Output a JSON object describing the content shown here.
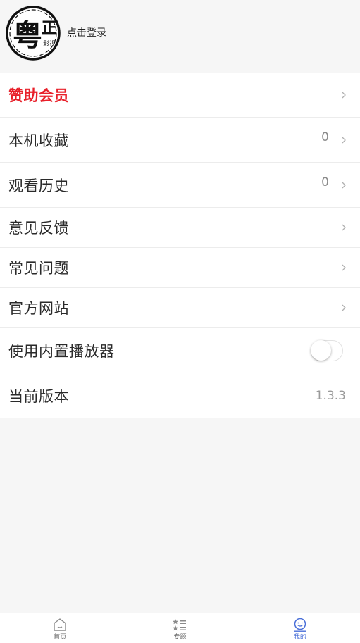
{
  "header": {
    "logo_char": "粤",
    "logo_side_char": "正",
    "logo_small_text": "影视",
    "login_label": "点击登录"
  },
  "list": {
    "sponsor": {
      "label": "赞助会员"
    },
    "favorites": {
      "label": "本机收藏",
      "count": "0"
    },
    "history": {
      "label": "观看历史",
      "count": "0"
    },
    "feedback": {
      "label": "意见反馈"
    },
    "faq": {
      "label": "常见问题"
    },
    "website": {
      "label": "官方网站"
    },
    "builtin_player": {
      "label": "使用内置播放器",
      "enabled": false
    },
    "version": {
      "label": "当前版本",
      "value": "1.3.3"
    }
  },
  "tabbar": {
    "tabs": [
      {
        "label": "首页",
        "icon": "home-icon",
        "active": false
      },
      {
        "label": "专题",
        "icon": "topics-list-icon",
        "active": false
      },
      {
        "label": "我的",
        "icon": "profile-smile-icon",
        "active": true
      }
    ]
  },
  "colors": {
    "accent": "#4a6fd8",
    "vip": "#e8202a"
  }
}
